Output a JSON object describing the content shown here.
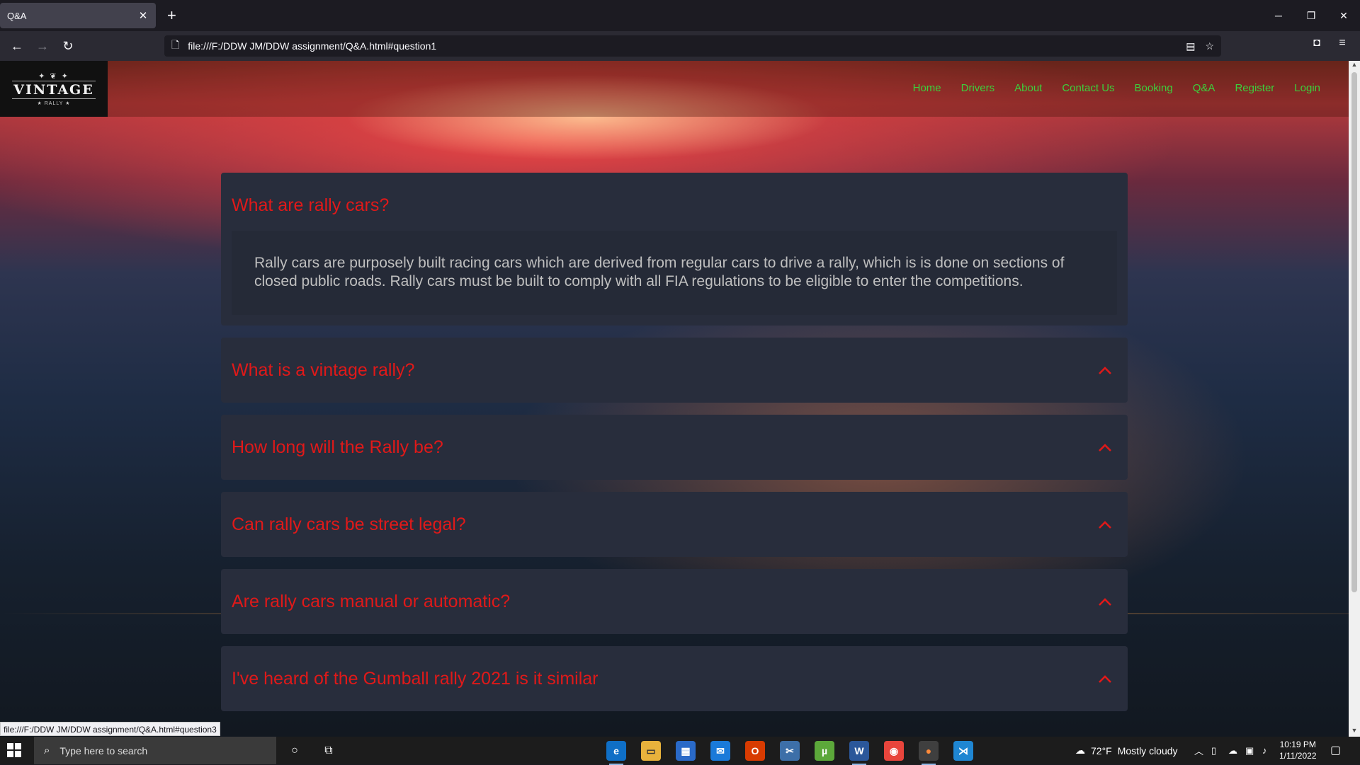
{
  "browser": {
    "tab_title": "Q&A",
    "tab_close": "✕",
    "new_tab": "+",
    "url": "file:///F:/DDW JM/DDW assignment/Q&A.html#question1",
    "status_url": "file:///F:/DDW JM/DDW assignment/Q&A.html#question3"
  },
  "site": {
    "logo": {
      "mark": "✦ ❦ ✦",
      "name": "VINTAGE",
      "sub": "★ RALLY ★"
    },
    "nav": [
      "Home",
      "Drivers",
      "About",
      "Contact Us",
      "Booking",
      "Q&A",
      "Register",
      "Login"
    ],
    "accent_color": "#3cd03c"
  },
  "faq": {
    "question_color": "#e01919",
    "open": {
      "question": "What are rally cars?",
      "answer": "Rally cars are purposely built racing cars which are derived from regular cars to drive a rally, which is is done on sections of closed public roads. Rally cars must be built to comply with all FIA regulations to be eligible to enter the competitions."
    },
    "collapsed": [
      "What is a vintage rally?",
      "How long will the Rally be?",
      "Can rally cars be street legal?",
      "Are rally cars manual or automatic?",
      "I've heard of the Gumball rally 2021 is it similar"
    ]
  },
  "taskbar": {
    "search_placeholder": "Type here to search",
    "weather_temp": "72°F",
    "weather_text": "Mostly cloudy",
    "time": "10:19 PM",
    "date": "1/11/2022",
    "apps": [
      "edge-icon",
      "file-explorer-icon",
      "store-icon",
      "mail-icon",
      "office-icon",
      "snipping-icon",
      "utorrent-icon",
      "word-icon",
      "chrome-icon",
      "firefox-icon",
      "vscode-icon"
    ]
  }
}
